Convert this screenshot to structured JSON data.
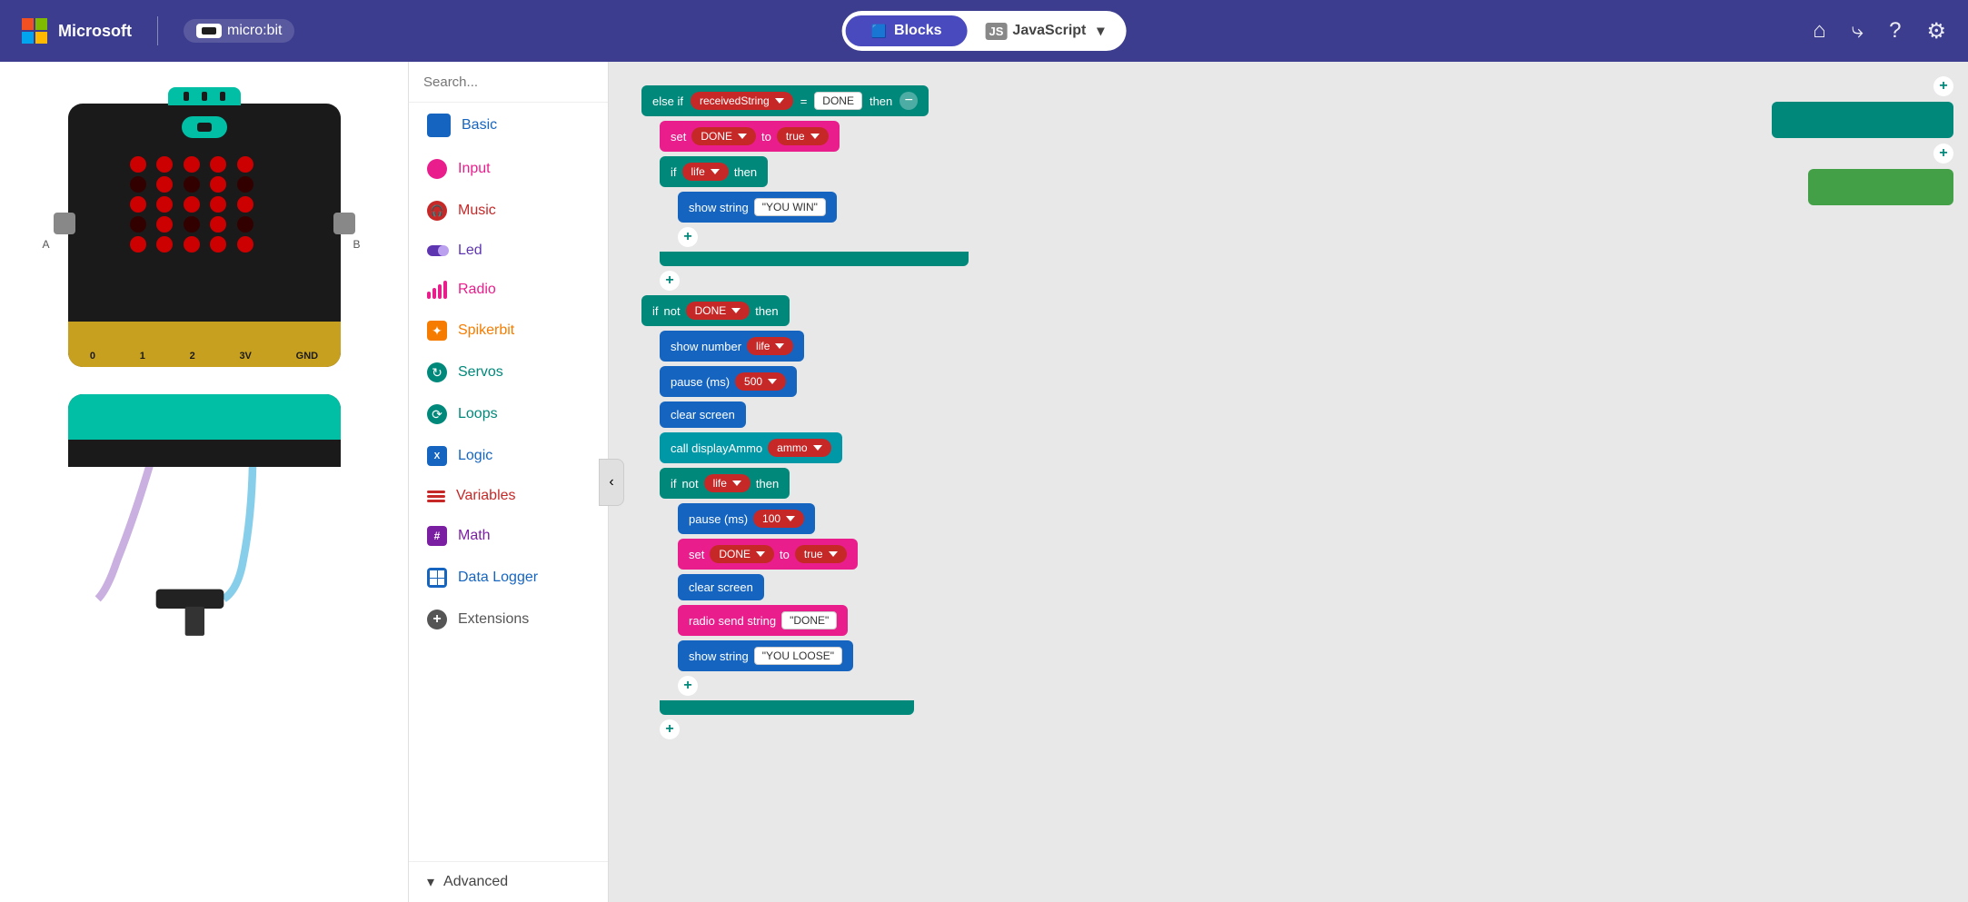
{
  "header": {
    "microsoft_label": "Microsoft",
    "microbit_label": "micro:bit",
    "blocks_label": "Blocks",
    "javascript_label": "JavaScript",
    "tab_active": "blocks"
  },
  "search": {
    "placeholder": "Search..."
  },
  "toolbox": {
    "items": [
      {
        "id": "basic",
        "label": "Basic",
        "color": "#1565c0",
        "icon": "grid"
      },
      {
        "id": "input",
        "label": "Input",
        "color": "#e91e8c",
        "icon": "circle"
      },
      {
        "id": "music",
        "label": "Music",
        "color": "#c62828",
        "icon": "headphone"
      },
      {
        "id": "led",
        "label": "Led",
        "color": "#5e35b1",
        "icon": "toggle"
      },
      {
        "id": "radio",
        "label": "Radio",
        "color": "#e91e8c",
        "icon": "bars"
      },
      {
        "id": "spikerbit",
        "label": "Spikerbit",
        "color": "#f57c00",
        "icon": "star"
      },
      {
        "id": "servos",
        "label": "Servos",
        "color": "#00897b",
        "icon": "refresh"
      },
      {
        "id": "loops",
        "label": "Loops",
        "color": "#00897b",
        "icon": "loop"
      },
      {
        "id": "logic",
        "label": "Logic",
        "color": "#1565c0",
        "icon": "logic"
      },
      {
        "id": "variables",
        "label": "Variables",
        "color": "#c62828",
        "icon": "lines"
      },
      {
        "id": "math",
        "label": "Math",
        "color": "#7b1fa2",
        "icon": "math"
      },
      {
        "id": "datalogger",
        "label": "Data Logger",
        "color": "#1565c0",
        "icon": "table"
      },
      {
        "id": "extensions",
        "label": "Extensions",
        "color": "#555",
        "icon": "plus"
      }
    ],
    "advanced_label": "Advanced"
  },
  "blocks": {
    "else_if_label": "else if",
    "received_string_label": "receivedString",
    "equals_label": "=",
    "done_val": "DONE",
    "then_label": "then",
    "set_label": "set",
    "done_var": "DONE",
    "to_label": "to",
    "true_val": "true",
    "if_label": "if",
    "life_var": "life",
    "then2_label": "then",
    "show_string_label": "show string",
    "you_win_val": "YOU WIN",
    "if2_label": "if",
    "not_label": "not",
    "done_var2": "DONE",
    "then3_label": "then",
    "show_number_label": "show number",
    "life_var2": "life",
    "pause_label": "pause (ms)",
    "pause_val": "500",
    "clear_screen_label": "clear screen",
    "call_label": "call displayAmmo",
    "ammo_val": "ammo",
    "if3_label": "if",
    "not2_label": "not",
    "life_var3": "life",
    "then4_label": "then",
    "pause2_label": "pause (ms)",
    "pause2_val": "100",
    "set2_label": "set",
    "done2_var": "DONE",
    "to2_label": "to",
    "true2_val": "true",
    "clear_screen2_label": "clear screen",
    "radio_send_label": "radio send string",
    "done_str_val": "DONE",
    "show_string2_label": "show string",
    "you_loose_val": "YOU LOOSE"
  },
  "pins": [
    "0",
    "1",
    "2",
    "3V",
    "GND"
  ],
  "right_panel": {
    "teal_block1": "",
    "teal_block2": "",
    "teal_block3": "",
    "green_block": ""
  }
}
